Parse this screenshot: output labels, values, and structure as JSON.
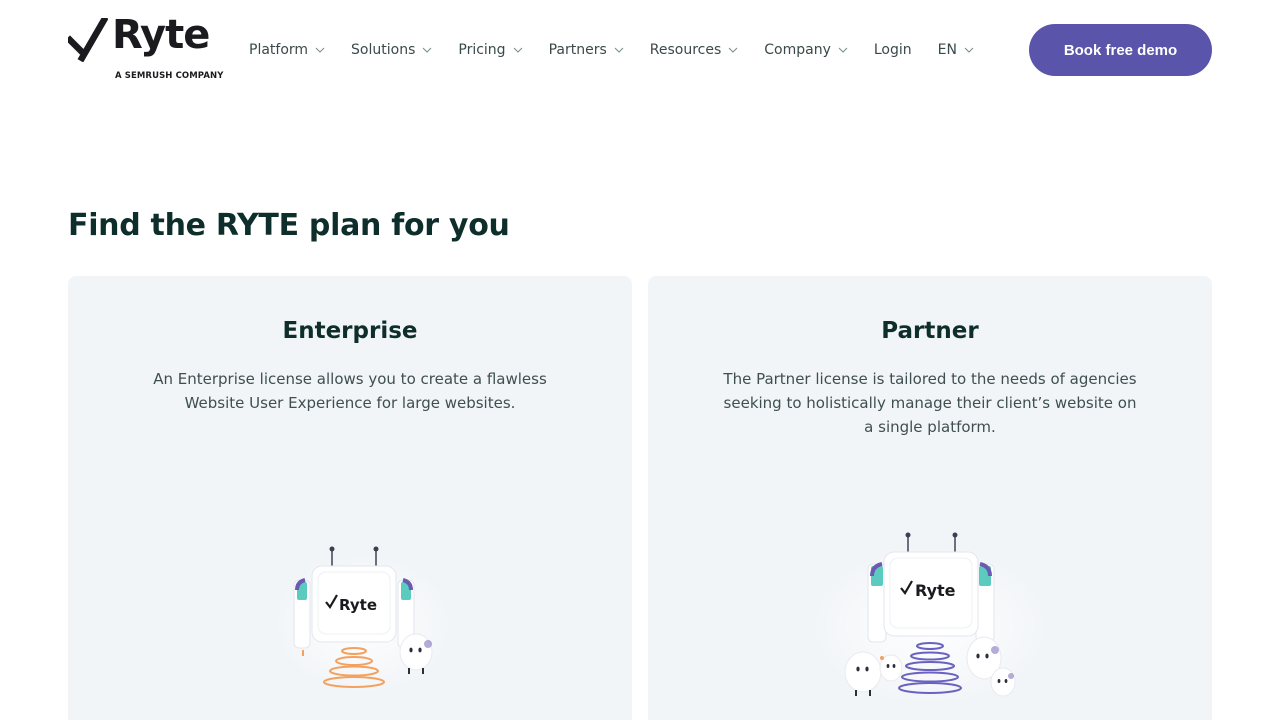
{
  "header": {
    "logo": {
      "word": "Ryte",
      "subtitle": "A SEMRUSH COMPANY"
    },
    "nav": [
      {
        "label": "Platform",
        "dropdown": true
      },
      {
        "label": "Solutions",
        "dropdown": true
      },
      {
        "label": "Pricing",
        "dropdown": true
      },
      {
        "label": "Partners",
        "dropdown": true
      },
      {
        "label": "Resources",
        "dropdown": true
      },
      {
        "label": "Company",
        "dropdown": true
      },
      {
        "label": "Login",
        "dropdown": false
      },
      {
        "label": "EN",
        "dropdown": true
      }
    ],
    "cta_label": "Book free demo"
  },
  "main": {
    "title": "Find the RYTE plan for you",
    "plans": [
      {
        "name": "Enterprise",
        "description": "An Enterprise license allows you to create a flawless Website User Experience for large websites.",
        "illustration": "robot-orange-rings-icon"
      },
      {
        "name": "Partner",
        "description": "The Partner license is tailored to the needs of agencies seeking to holistically manage their client’s website on a single platform.",
        "illustration": "robot-purple-rings-icon"
      }
    ]
  },
  "colors": {
    "brand_purple": "#5a55aa",
    "heading_dark": "#0d2e2a",
    "card_bg": "#f2f5f8",
    "accent_orange": "#f2a25e",
    "accent_teal": "#5ccbbf"
  }
}
